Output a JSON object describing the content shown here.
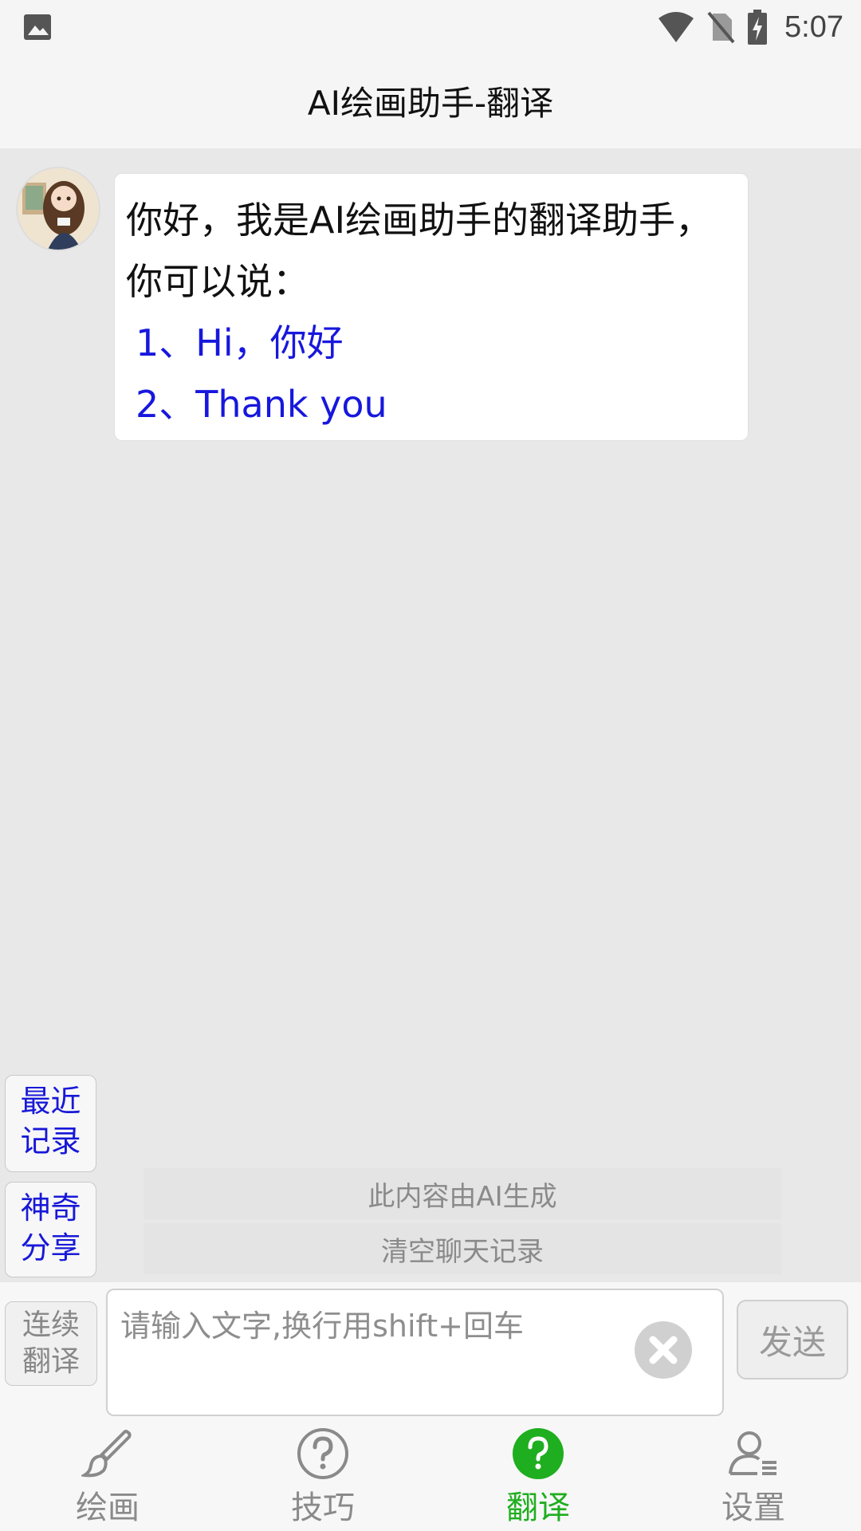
{
  "status_bar": {
    "time": "5:07",
    "icons": [
      "gallery-icon",
      "wifi-icon",
      "no-sim-icon",
      "battery-charging-icon"
    ]
  },
  "header": {
    "title": "AI绘画助手-翻译"
  },
  "chat": {
    "messages": [
      {
        "sender": "assistant",
        "text": "你好，我是AI绘画助手的翻译助手，你可以说：",
        "examples": [
          "1、Hi，你好",
          "2、Thank you"
        ]
      }
    ]
  },
  "side_buttons": {
    "recent": {
      "line1": "最近",
      "line2": "记录"
    },
    "share": {
      "line1": "神奇",
      "line2": "分享"
    }
  },
  "notes": {
    "ai_generated": "此内容由AI生成",
    "clear_history": "清空聊天记录"
  },
  "input": {
    "continuous": {
      "line1": "连续",
      "line2": "翻译"
    },
    "placeholder": "请输入文字,换行用shift+回车",
    "value": "",
    "send_label": "发送"
  },
  "bottom_nav": {
    "items": [
      {
        "label": "绘画",
        "icon": "brush-icon",
        "active": false
      },
      {
        "label": "技巧",
        "icon": "question-circle-icon",
        "active": false
      },
      {
        "label": "翻译",
        "icon": "question-circle-icon",
        "active": true
      },
      {
        "label": "设置",
        "icon": "user-settings-icon",
        "active": false
      }
    ],
    "active_color": "#1fae1f",
    "inactive_color": "#8a8a8a"
  },
  "colors": {
    "example_link": "#1717dd",
    "side_button_text": "#1818d8"
  }
}
